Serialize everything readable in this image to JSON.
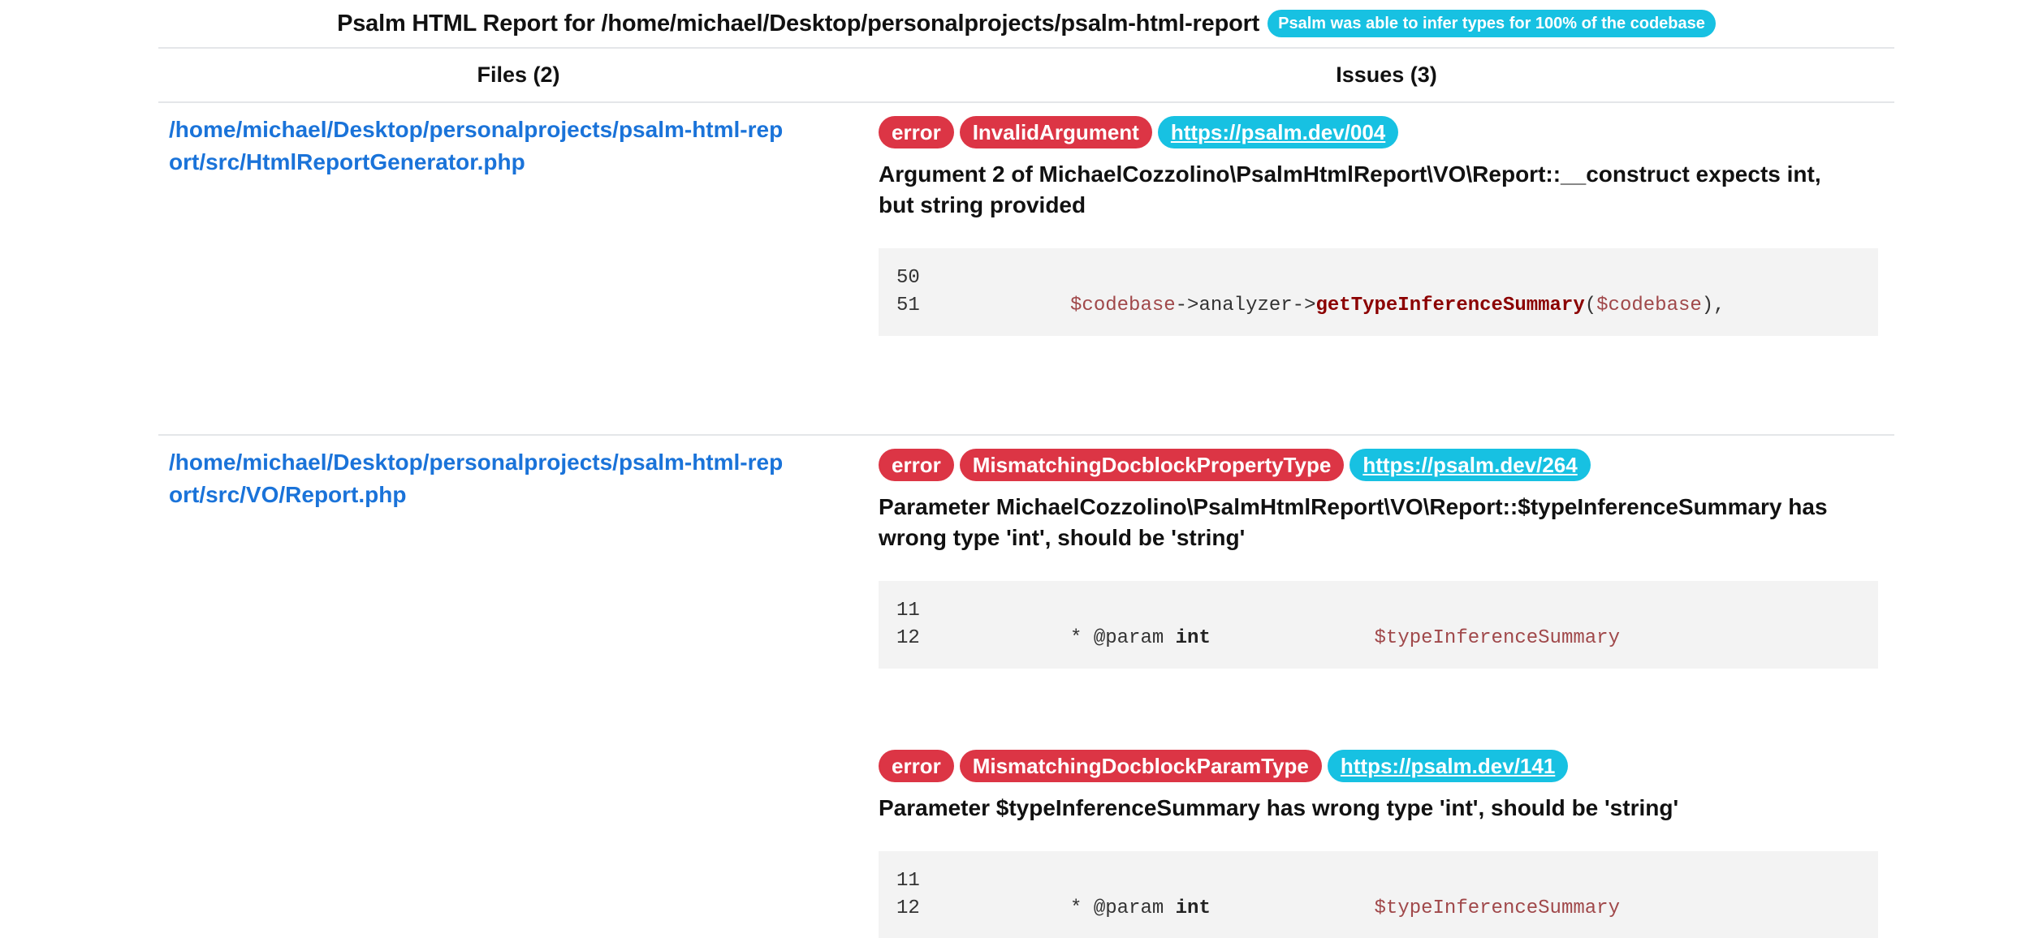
{
  "header": {
    "title": "Psalm HTML Report for /home/michael/Desktop/personalprojects/psalm-html-report",
    "coverage_badge": "Psalm was able to infer types for 100% of the codebase"
  },
  "table": {
    "files_header": "Files (2)",
    "issues_header": "Issues (3)"
  },
  "files": [
    {
      "path": "/home/michael/Desktop/personalprojects/psalm-html-report/src/HtmlReportGenerator.php",
      "issues": [
        {
          "severity": "error",
          "type": "InvalidArgument",
          "link": "https://psalm.dev/004",
          "message": "Argument 2 of MichaelCozzolino\\PsalmHtmlReport\\VO\\Report::__construct expects int, but string provided",
          "lines": [
            {
              "num": "50",
              "code": ""
            },
            {
              "num": "51",
              "indent": "          ",
              "var1": "$codebase",
              "mid": "->analyzer->",
              "fn": "getTypeInferenceSummary",
              "open": "(",
              "var2": "$codebase",
              "close": "),"
            }
          ]
        }
      ]
    },
    {
      "path": "/home/michael/Desktop/personalprojects/psalm-html-report/src/VO/Report.php",
      "issues": [
        {
          "severity": "error",
          "type": "MismatchingDocblockPropertyType",
          "link": "https://psalm.dev/264",
          "message": "Parameter MichaelCozzolino\\PsalmHtmlReport\\VO\\Report::$typeInferenceSummary has wrong type 'int', should be 'string'",
          "lines": [
            {
              "num": "11",
              "code": ""
            },
            {
              "num": "12",
              "prefix": "          * @param ",
              "kw": "int",
              "gap": "              ",
              "var": "$typeInferenceSummary"
            }
          ]
        },
        {
          "severity": "error",
          "type": "MismatchingDocblockParamType",
          "link": "https://psalm.dev/141",
          "message": "Parameter $typeInferenceSummary has wrong type 'int', should be 'string'",
          "lines": [
            {
              "num": "11",
              "code": ""
            },
            {
              "num": "12",
              "prefix": "          * @param ",
              "kw": "int",
              "gap": "              ",
              "var": "$typeInferenceSummary"
            }
          ]
        }
      ]
    }
  ],
  "colors": {
    "link_blue": "#1a73d9",
    "error_red": "#dc3545",
    "info_cyan": "#17c1e2",
    "snippet_bg": "#f3f3f3"
  }
}
